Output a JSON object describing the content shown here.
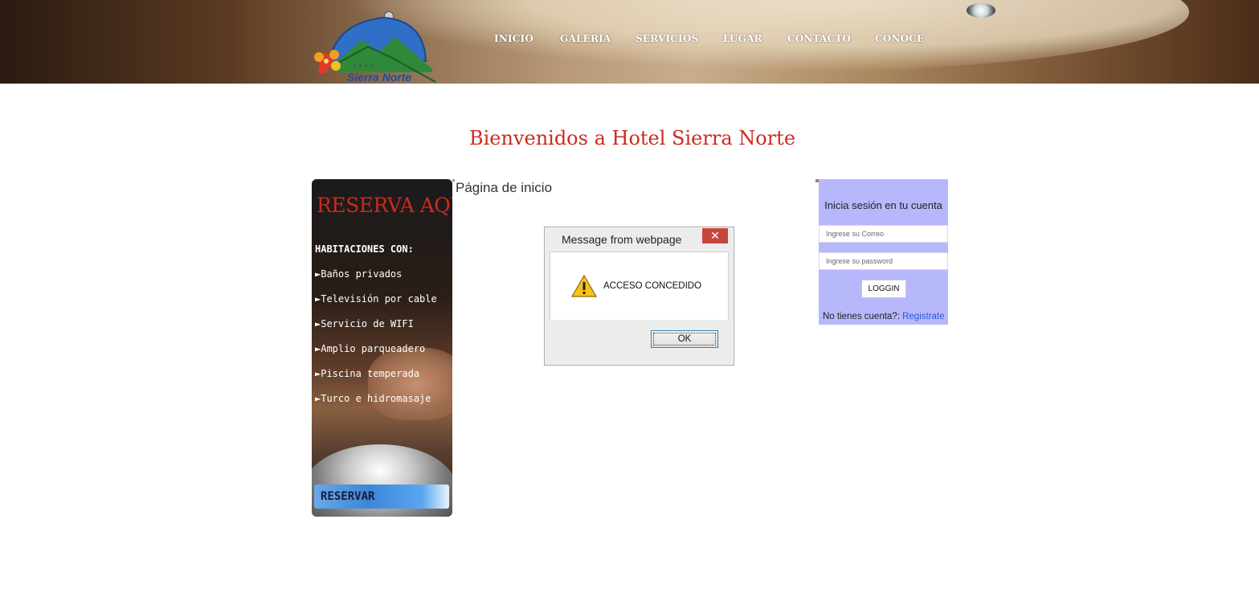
{
  "header": {
    "logo_text": "Sierra Norte",
    "logo_stars": "★★★★",
    "nav": [
      {
        "label": "INICIO"
      },
      {
        "label": "GALERÍA"
      },
      {
        "label": "SERVICIOS"
      },
      {
        "label": "LUGAR"
      },
      {
        "label": "CONTACTO"
      },
      {
        "label": "CONOCE"
      }
    ]
  },
  "welcome": "Bienvenidos a Hotel Sierra Norte",
  "reserve": {
    "title": "RESERVA AQUÍ",
    "heading": "HABITACIONES CON:",
    "items": [
      "►Baños privados",
      "►Televisión por cable",
      "►Servicio de WIFI",
      "►Amplio parqueadero",
      "►Piscina temperada",
      "►Turco e hidromasaje"
    ],
    "button": "RESERVAR"
  },
  "main": {
    "home_label": "Página de inicio"
  },
  "login": {
    "title": "Inicia sesión en tu cuenta",
    "email_placeholder": "Ingrese su Correo",
    "password_placeholder": "Ingrese su password",
    "button": "LOGGIN",
    "no_account": "No tienes cuenta?: ",
    "register": "Registrate"
  },
  "dialog": {
    "title": "Message from webpage",
    "close": "✕",
    "message": "ACCESO CONCEDIDO",
    "ok": "OK",
    "icon": "warning-icon"
  },
  "colors": {
    "accent_red": "#cc2a1e",
    "login_bg": "#b7b8fb",
    "link_blue": "#2a5bd8"
  }
}
